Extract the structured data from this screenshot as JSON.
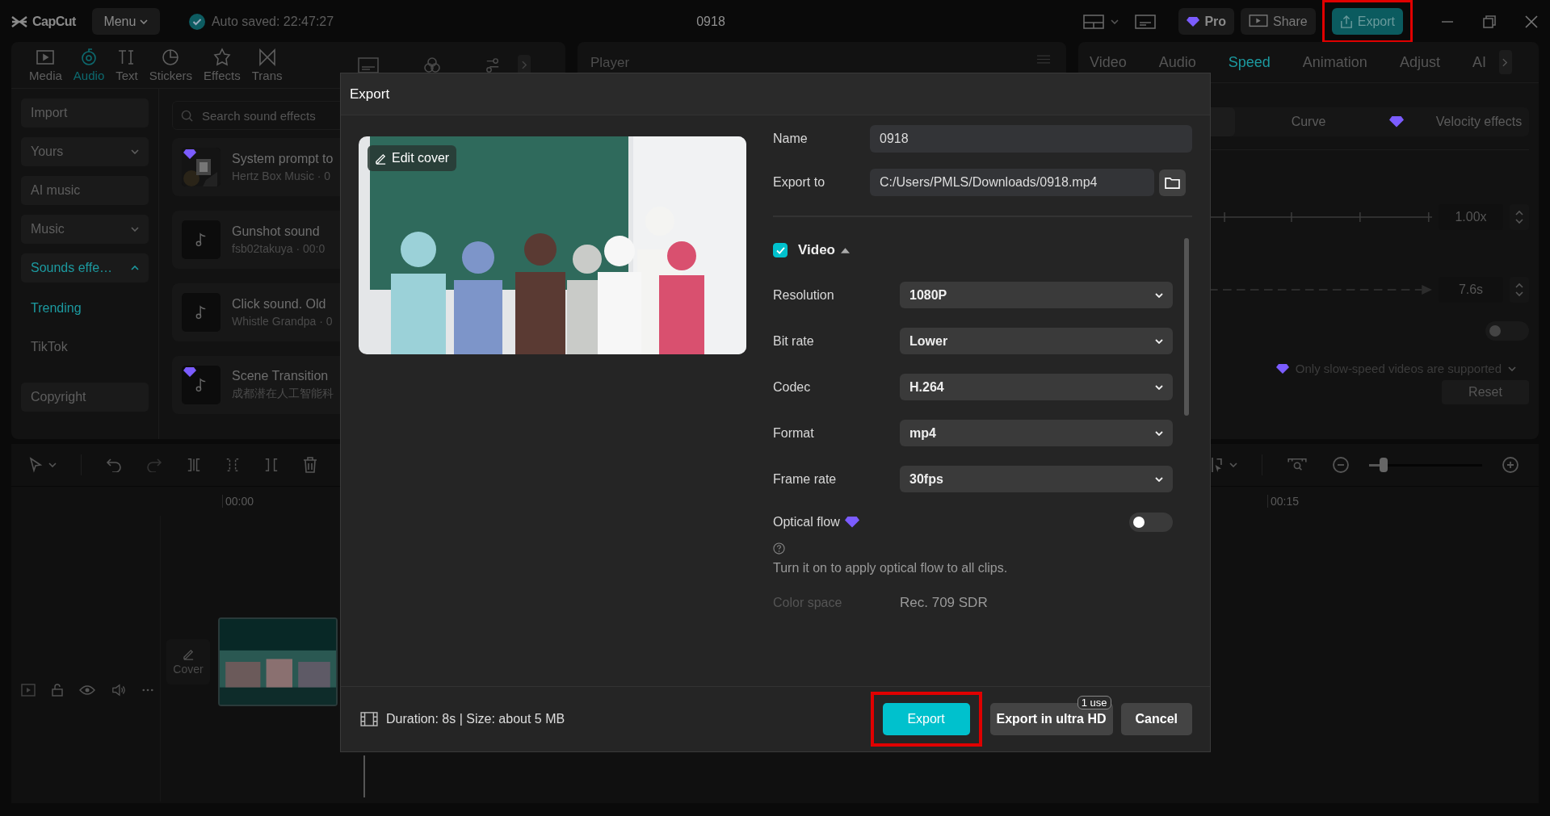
{
  "title_bar": {
    "app_name": "CapCut",
    "menu": "Menu",
    "autosave": "Auto saved: 22:47:27",
    "project_title": "0918",
    "pro": "Pro",
    "share": "Share",
    "export": {
      "label": "Export",
      "highlighted": true
    }
  },
  "media_tabs": [
    {
      "label": "Media",
      "selected": false
    },
    {
      "label": "Audio",
      "selected": true
    },
    {
      "label": "Text",
      "selected": false
    },
    {
      "label": "Stickers",
      "selected": false
    },
    {
      "label": "Effects",
      "selected": false
    },
    {
      "label": "Trans",
      "selected": false
    }
  ],
  "sidebar": {
    "items": [
      {
        "label": "Import",
        "kind": "button",
        "selected": false
      },
      {
        "label": "Yours",
        "kind": "dropdown",
        "selected": false,
        "expanded": false
      },
      {
        "label": "AI music",
        "kind": "button",
        "selected": false
      },
      {
        "label": "Music",
        "kind": "dropdown",
        "selected": false,
        "expanded": false
      },
      {
        "label": "Sounds effe…",
        "kind": "dropdown",
        "selected": true,
        "expanded": true,
        "children": [
          {
            "label": "Trending",
            "selected": true
          },
          {
            "label": "TikTok",
            "selected": false
          }
        ]
      },
      {
        "label": "Copyright",
        "kind": "button",
        "selected": false
      }
    ]
  },
  "sound_search": {
    "placeholder": "Search sound effects"
  },
  "sounds": [
    {
      "title": "System prompt to",
      "meta": "Hertz Box Music · 0",
      "kind": "picture",
      "pro": true
    },
    {
      "title": "Gunshot sound",
      "meta": "fsb02takuya · 00:0",
      "kind": "note",
      "pro": false
    },
    {
      "title": "Click sound. Old",
      "meta": "Whistle Grandpa · 0",
      "kind": "note",
      "pro": false
    },
    {
      "title": "Scene Transition",
      "meta": "成都潜在人工智能科",
      "kind": "note",
      "pro": true
    }
  ],
  "player": {
    "title": "Player"
  },
  "speed_panel": {
    "tabs": [
      {
        "label": "Video",
        "selected": false
      },
      {
        "label": "Audio",
        "selected": false
      },
      {
        "label": "Speed",
        "selected": true
      },
      {
        "label": "Animation",
        "selected": false
      },
      {
        "label": "Adjust",
        "selected": false
      },
      {
        "label": "AI",
        "selected": false
      }
    ],
    "modes": [
      {
        "label": "Curve",
        "pro": false,
        "selected": false
      },
      {
        "label": "Velocity effects",
        "pro": true,
        "selected": false
      }
    ],
    "speed": "1.00x",
    "duration": "7.6s",
    "toggle_on": false,
    "note": "Only slow-speed videos are supported",
    "reset": "Reset"
  },
  "timeline": {
    "ruler": [
      "00:00",
      "00:15"
    ],
    "cover": "Cover",
    "zoom": {
      "level": 0.13
    }
  },
  "dialog": {
    "title": "Export",
    "edit_cover": "Edit cover",
    "name": {
      "label": "Name",
      "value": "0918"
    },
    "export_to": {
      "label": "Export to",
      "value": "C:/Users/PMLS/Downloads/0918.mp4"
    },
    "video": {
      "label": "Video",
      "checked": true,
      "expanded": true
    },
    "settings": [
      {
        "label": "Resolution",
        "value": "1080P"
      },
      {
        "label": "Bit rate",
        "value": "Lower"
      },
      {
        "label": "Codec",
        "value": "H.264"
      },
      {
        "label": "Format",
        "value": "mp4"
      },
      {
        "label": "Frame rate",
        "value": "30fps"
      }
    ],
    "optical_flow": {
      "label": "Optical flow",
      "pro": true,
      "on": false,
      "hint": "Turn it on to apply optical flow to all clips."
    },
    "color_space": {
      "label": "Color space",
      "value": "Rec. 709 SDR",
      "disabled": true
    },
    "info": "Duration: 8s | Size: about 5 MB",
    "export_button": {
      "label": "Export",
      "highlighted": true
    },
    "ultra_button": {
      "label": "Export in ultra HD",
      "badge": "1 use"
    },
    "cancel": "Cancel"
  }
}
